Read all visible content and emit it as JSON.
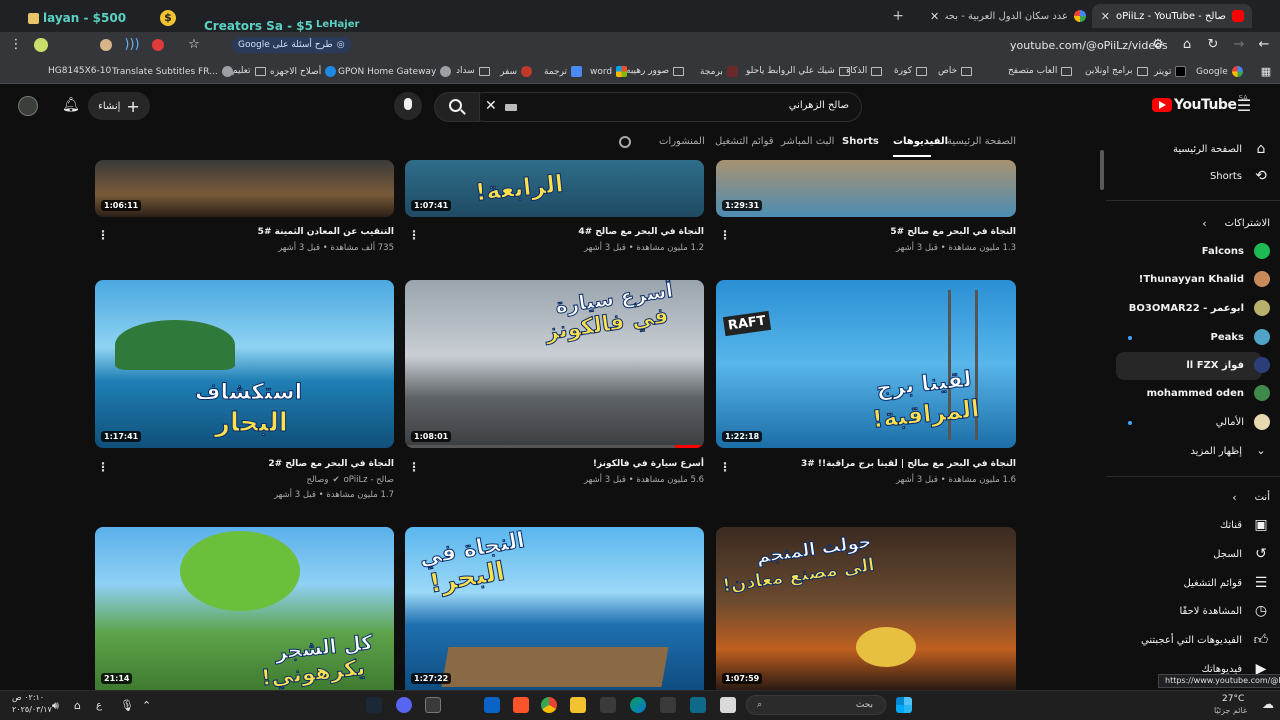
{
  "browser": {
    "extensions": [
      {
        "label": "layan - $500",
        "color": "#5ad1c2"
      },
      {
        "label": "Creators Sa - $5",
        "color": "#5ad1c2"
      },
      {
        "label": "LeHajer",
        "color": "#5ad1c2"
      }
    ],
    "tabs": [
      {
        "label": "عدد سكان الدول العربية - بحث Google",
        "active": false
      },
      {
        "label": "صالح - oPiiLz - YouTube",
        "active": true
      }
    ],
    "new_tab_icon": "+",
    "url": "youtube.com/@oPiiLz/videos",
    "google_pill": "طرح أسئلة على Google",
    "bookmarks": [
      "Google",
      "تويتر",
      "برامج اونلاين",
      "العاب متصفح",
      "خاص",
      "كورة",
      "الذكاء",
      "شيك علي الروابط ياحلو",
      "برمجة",
      "صوور رهيبه",
      "word",
      "ترجمة",
      "سفر",
      "سداد",
      "GPON Home Gateway",
      "أصلاح الاجهزه",
      "تعليم",
      "Translate Subtitles FR...",
      "HG8145X6-10"
    ],
    "status_url": "https://www.youtube.com/@FZX"
  },
  "youtube": {
    "logo": "YouTube",
    "region": "SA",
    "search_value": "صالح الزهراني",
    "create_label": "إنشاء",
    "channel_tabs": [
      "الصفحة الرئيسية",
      "الفيديوهات",
      "Shorts",
      "البث المباشر",
      "قوائم التشغيل",
      "المنشورات"
    ],
    "sidebar": {
      "main": [
        {
          "label": "الصفحة الرئيسية",
          "icon": "home-icon"
        },
        {
          "label": "Shorts",
          "icon": "shorts-icon"
        }
      ],
      "subscriptions_title": "الاشتراكات",
      "subscriptions": [
        {
          "label": "Falcons",
          "color": "#1db954"
        },
        {
          "label": "Thunayyan Khalid!",
          "color": "#c98a5a"
        },
        {
          "label": "ابوعمر - BO3OMAR22",
          "color": "#b8b06a"
        },
        {
          "label": "Peaks",
          "color": "#4fa3c7"
        },
        {
          "label": "فواز ll FZX",
          "color": "#2c3e7a"
        },
        {
          "label": "mohammed oden",
          "color": "#3f8a4a"
        },
        {
          "label": "الأمالي",
          "color": "#e8d8b0"
        }
      ],
      "show_more": "إظهار المزيد",
      "you_title": "أنت",
      "you_items": [
        {
          "label": "قناتك",
          "icon": "channel-icon"
        },
        {
          "label": "السجل",
          "icon": "history-icon"
        },
        {
          "label": "قوائم التشغيل",
          "icon": "playlists-icon"
        },
        {
          "label": "المشاهدة لاحقًا",
          "icon": "watch-later-icon"
        },
        {
          "label": "الفيديوهات التي أعجبتني",
          "icon": "liked-icon"
        },
        {
          "label": "فيديوهاتك",
          "icon": "your-videos-icon"
        }
      ]
    },
    "videos": [
      {
        "title": "التنقيب عن المعادن الثمينة #5",
        "views": "735 ألف مشاهدة",
        "age": "قبل 3 أشهر",
        "duration": "1:06:11"
      },
      {
        "title": "النجاة في البحر مع صالح #4",
        "views": "1.2 مليون مشاهدة",
        "age": "قبل 3 أشهر",
        "duration": "1:07:41",
        "overlay": "الرابعة!"
      },
      {
        "title": "النجاة في البحر مع صالح #5",
        "views": "1.3 مليون مشاهدة",
        "age": "قبل 3 أشهر",
        "duration": "1:29:31"
      },
      {
        "title": "النجاة في البحر مع صالح #2",
        "channel": "صالح - oPiiLz",
        "collab": "وصالح",
        "views": "1.7 مليون مشاهدة",
        "age": "قبل 3 أشهر",
        "duration": "1:17:41",
        "overlay1": "استكشاف",
        "overlay2": "البحار"
      },
      {
        "title": "أسرع سيارة في فالكونز!",
        "views": "5.6 مليون مشاهدة",
        "age": "قبل 3 أشهر",
        "duration": "1:08:01",
        "overlay1": "أسرع سيارة",
        "overlay2": "في فالكونز"
      },
      {
        "title": "النجاة في البحر مع صالح | لقينا برج مراقبة!! #3",
        "views": "1.6 مليون مشاهدة",
        "age": "قبل 3 أشهر",
        "duration": "1:22:18",
        "overlay1": "لقينا برج",
        "overlay2": "المراقبة!",
        "badge": "RAFT"
      },
      {
        "duration": "21:14",
        "overlay1": "كل الشجر",
        "overlay2": "يكرهوني!"
      },
      {
        "duration": "1:27:22",
        "overlay1": "النجاة في",
        "overlay2": "البحر!"
      },
      {
        "duration": "1:07:59",
        "overlay1": "حولت المنجم",
        "overlay2": "الى مصنع معادن!"
      }
    ]
  },
  "taskbar": {
    "search_placeholder": "بحث",
    "weather_temp": "27°C",
    "weather_desc": "غائم جزئيًا",
    "time": "٠٢:١٠ ص",
    "date": "٢٠٢٥/٠٣/١٧",
    "lang": "ع"
  }
}
